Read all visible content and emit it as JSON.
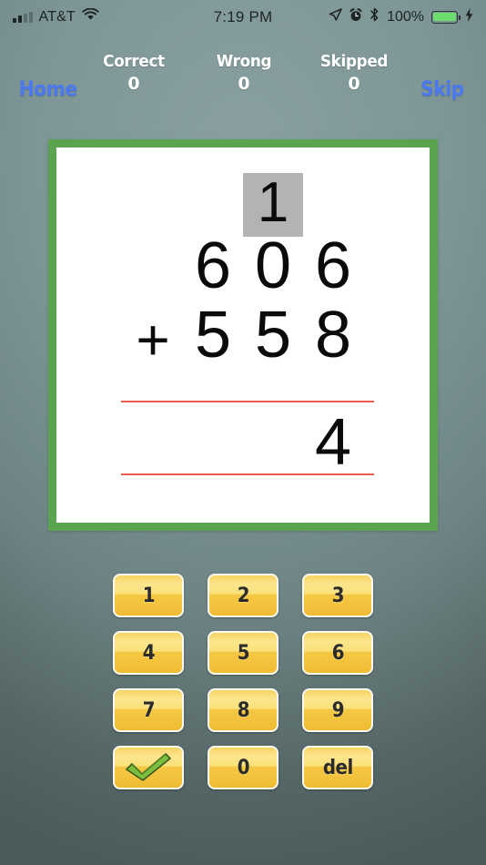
{
  "status_bar": {
    "carrier": "AT&T",
    "signal_icon": "cellular-bars-icon",
    "wifi_icon": "wifi-icon",
    "time": "7:19 PM",
    "location_icon": "location-arrow-icon",
    "alarm_icon": "alarm-clock-icon",
    "bluetooth_icon": "bluetooth-icon",
    "battery_percent": "100%",
    "battery_icon": "battery-full-icon",
    "charging_icon": "lightning-bolt-icon",
    "battery_fill_color": "#6fdc6f"
  },
  "header": {
    "home_label": "Home",
    "skip_label": "Skip",
    "link_color": "#4a79f0",
    "counters": [
      {
        "label": "Correct",
        "value": "0"
      },
      {
        "label": "Wrong",
        "value": "0"
      },
      {
        "label": "Skipped",
        "value": "0"
      }
    ]
  },
  "problem": {
    "border_color": "#5aa44f",
    "rule_color": "#ea5a4f",
    "carry_highlight_color": "#b3b3b3",
    "operator": "+",
    "carries": [
      "1"
    ],
    "top_operand": [
      "6",
      "0",
      "6"
    ],
    "bottom_operand": [
      "5",
      "5",
      "8"
    ],
    "answer": [
      "4"
    ]
  },
  "keypad": {
    "keys": [
      {
        "label": "1",
        "name": "key-1"
      },
      {
        "label": "2",
        "name": "key-2"
      },
      {
        "label": "3",
        "name": "key-3"
      },
      {
        "label": "4",
        "name": "key-4"
      },
      {
        "label": "5",
        "name": "key-5"
      },
      {
        "label": "6",
        "name": "key-6"
      },
      {
        "label": "7",
        "name": "key-7"
      },
      {
        "label": "8",
        "name": "key-8"
      },
      {
        "label": "9",
        "name": "key-9"
      },
      {
        "label": "",
        "name": "key-submit-check",
        "icon": "checkmark-icon"
      },
      {
        "label": "0",
        "name": "key-0"
      },
      {
        "label": "del",
        "name": "key-delete"
      }
    ]
  }
}
